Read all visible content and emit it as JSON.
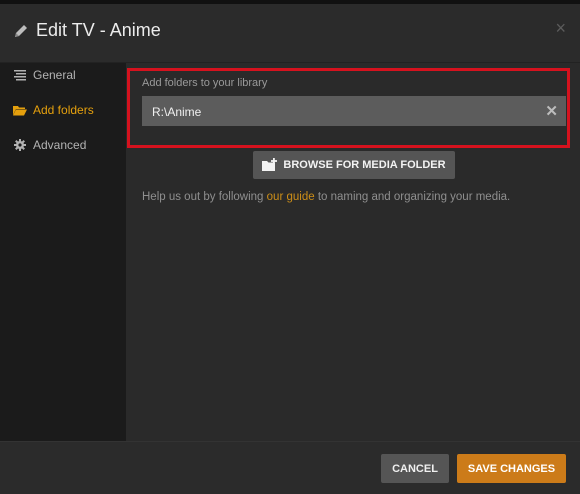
{
  "header": {
    "title": "Edit TV - Anime",
    "close_glyph": "×"
  },
  "sidebar": {
    "items": [
      {
        "label": "General",
        "icon": "list-icon",
        "active": false
      },
      {
        "label": "Add folders",
        "icon": "folder-open-icon",
        "active": true
      },
      {
        "label": "Advanced",
        "icon": "gear-icon",
        "active": false
      }
    ]
  },
  "folders": {
    "label": "Add folders to your library",
    "value": "R:\\Anime",
    "clear_glyph": "✕",
    "browse_label": "BROWSE FOR MEDIA FOLDER"
  },
  "help": {
    "prefix": "Help us out by following ",
    "link": "our guide",
    "suffix": " to naming and organizing your media."
  },
  "footer": {
    "cancel_label": "CANCEL",
    "save_label": "SAVE CHANGES"
  },
  "colors": {
    "accent": "#e5a00d",
    "highlight": "#d5121e",
    "save": "#cc7b19"
  }
}
